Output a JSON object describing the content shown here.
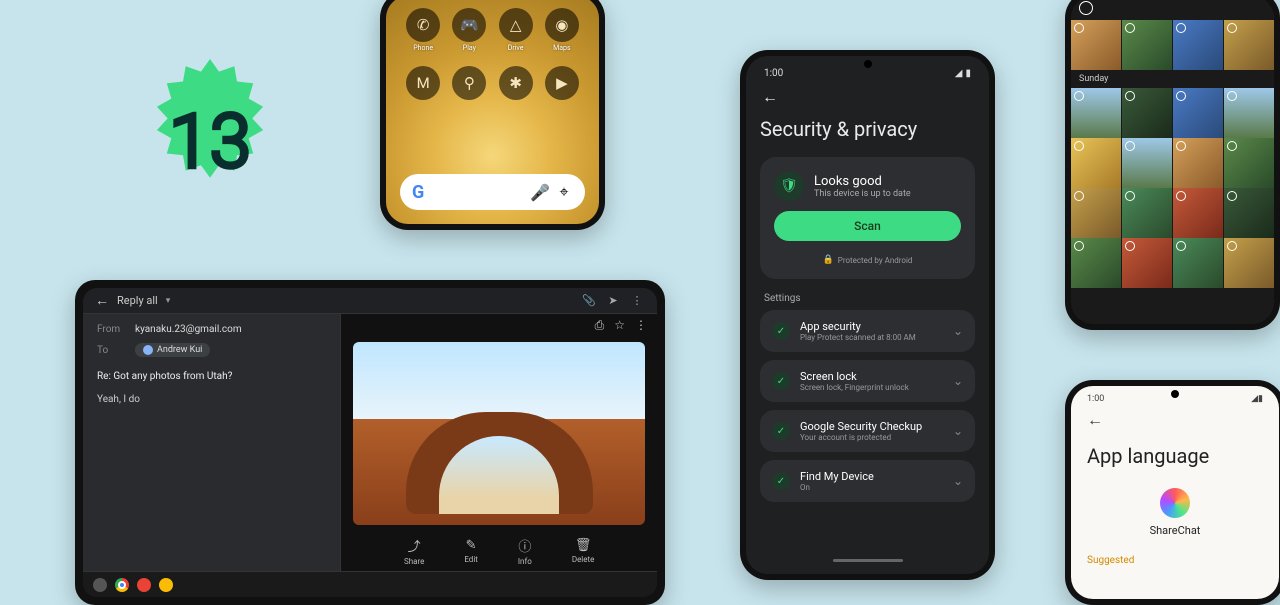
{
  "badge": {
    "number": "13"
  },
  "phone_home": {
    "row1": [
      {
        "icon": "phone",
        "label": "Phone"
      },
      {
        "icon": "game",
        "label": "Play"
      },
      {
        "icon": "drive",
        "label": "Drive"
      },
      {
        "icon": "maps",
        "label": "Maps"
      }
    ],
    "row2": [
      {
        "icon": "gmail",
        "label": "Gmail"
      },
      {
        "icon": "pin",
        "label": ""
      },
      {
        "icon": "photos",
        "label": ""
      },
      {
        "icon": "youtube",
        "label": ""
      }
    ],
    "search_placeholder": "G"
  },
  "tablet": {
    "header": {
      "back": "←",
      "title": "Reply all"
    },
    "from_label": "From",
    "from_value": "kyanaku.23@gmail.com",
    "to_label": "To",
    "to_chip": "Andrew Kui",
    "subject": "Re: Got any photos from Utah?",
    "body": "Yeah, I do",
    "actions": [
      {
        "icon": "share",
        "label": "Share"
      },
      {
        "icon": "edit",
        "label": "Edit"
      },
      {
        "icon": "info",
        "label": "Info"
      },
      {
        "icon": "delete",
        "label": "Delete"
      }
    ]
  },
  "phone_security": {
    "time": "1:00",
    "title": "Security & privacy",
    "status_title": "Looks good",
    "status_sub": "This device is up to date",
    "scan_label": "Scan",
    "protected_label": "Protected by Android",
    "settings_label": "Settings",
    "items": [
      {
        "title": "App security",
        "sub": "Play Protect scanned at 8:00 AM"
      },
      {
        "title": "Screen lock",
        "sub": "Screen lock, Fingerprint unlock"
      },
      {
        "title": "Google Security Checkup",
        "sub": "Your account is protected"
      },
      {
        "title": "Find My Device",
        "sub": "On"
      }
    ]
  },
  "phone_photos": {
    "day_label": "Sunday"
  },
  "phone_lang": {
    "time": "1:00",
    "title": "App language",
    "app_name": "ShareChat",
    "suggested_label": "Suggested"
  }
}
